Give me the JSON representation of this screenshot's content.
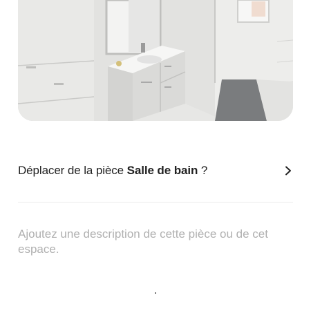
{
  "photo": {
    "subject": "bathroom-photo"
  },
  "move_room": {
    "prefix": "Déplacer de la pièce",
    "room_name": "Salle de bain",
    "suffix": "?",
    "chevron_icon": "chevron-right-icon"
  },
  "description": {
    "placeholder": "Ajoutez une description de cette pièce ou de cet espace."
  },
  "colors": {
    "text": "#222222",
    "placeholder": "#b0b0b0",
    "divider": "#ebebeb"
  }
}
